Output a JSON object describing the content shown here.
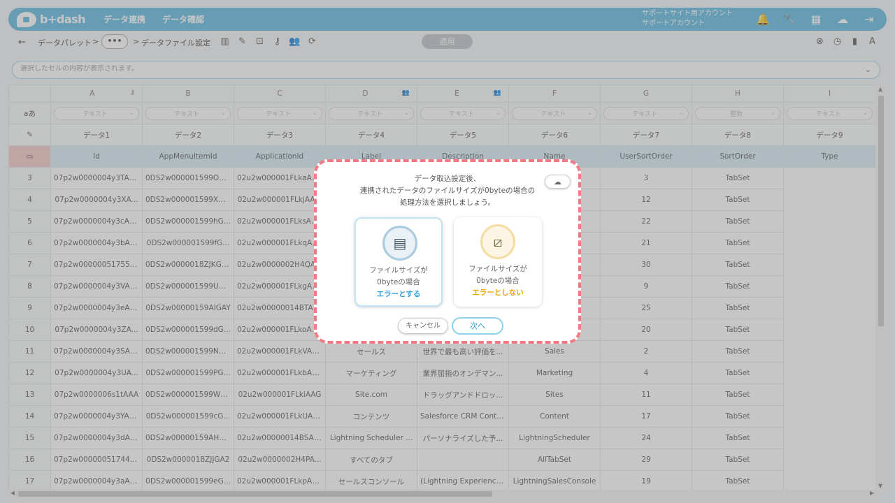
{
  "brand": {
    "logo_text": "b+dash"
  },
  "topnav": {
    "items": [
      "データ連携",
      "データ確認"
    ]
  },
  "account": {
    "line1": "サポートサイト用アカウント",
    "line2": "サポートアカウント"
  },
  "toolbar": {
    "back": "←",
    "crumb1": "データパレット",
    "sep": ">",
    "more": "•••",
    "crumb2": "データファイル設定",
    "apply": "適用"
  },
  "cellbar": {
    "placeholder": "選択したセルの内容が表示されます。"
  },
  "grid": {
    "columns": [
      "A",
      "B",
      "C",
      "D",
      "E",
      "F",
      "G",
      "H",
      "I"
    ],
    "type_label": "aあ",
    "types": [
      "テキスト",
      "テキスト",
      "テキスト",
      "テキスト",
      "テキスト",
      "テキスト",
      "テキスト",
      "整数",
      "テキスト"
    ],
    "labels": [
      "データ1",
      "データ2",
      "データ3",
      "データ4",
      "データ5",
      "データ6",
      "データ7",
      "データ8",
      "データ9"
    ],
    "fields": [
      "Id",
      "AppMenuItemId",
      "ApplicationId",
      "Label",
      "Description",
      "Name",
      "UserSortOrder",
      "SortOrder",
      "Type"
    ],
    "rows": [
      [
        "3",
        "07p2w0000004y3TAAQ",
        "0DS2w000001599OG...",
        "02u2w000001FLkaAA...",
        "",
        "",
        "",
        "3",
        "TabSet"
      ],
      [
        "4",
        "07p2w0000004y3XA...",
        "0DS2w000001599XG...",
        "02u2w000001FLkjAA...",
        "",
        "",
        "",
        "12",
        "TabSet"
      ],
      [
        "5",
        "07p2w0000004y3cAAA",
        "0DS2w000001599hG...",
        "02u2w000001FLksAA...",
        "",
        "",
        "",
        "22",
        "TabSet"
      ],
      [
        "6",
        "07p2w0000004y3bAAA",
        "0DS2w000001599fG...",
        "02u2w000001FLkqAA...",
        "",
        "",
        "",
        "21",
        "TabSet"
      ],
      [
        "7",
        "07p2w00000051755AAA",
        "0DS2w0000018ZJKGA2",
        "02u2w0000002H4QA...",
        "",
        "",
        "",
        "30",
        "TabSet"
      ],
      [
        "8",
        "07p2w0000004y3VAAQ",
        "0DS2w000001599UG...",
        "02u2w000001FLkgAA...",
        "",
        "",
        "",
        "9",
        "TabSet"
      ],
      [
        "9",
        "07p2w0000004y3eAAA",
        "0DS2w00000159AIGAY",
        "02u2w00000014BTAA...",
        "",
        "",
        "",
        "25",
        "TabSet"
      ],
      [
        "10",
        "07p2w0000004y3ZA...",
        "0DS2w000001599dG...",
        "02u2w000001FLkoAA...",
        "",
        "",
        "",
        "20",
        "TabSet"
      ],
      [
        "11",
        "07p2w0000004y3SAAQ",
        "0DS2w000001599NG...",
        "02u2w000001FLkVAAW",
        "セールス",
        "世界で最も高い評価を...",
        "Sales",
        "2",
        "TabSet"
      ],
      [
        "12",
        "07p2w0000004y3UA...",
        "0DS2w000001599PG...",
        "02u2w000001FLkbAAG",
        "マーケティング",
        "業界屈指のオンデマン...",
        "Marketing",
        "4",
        "TabSet"
      ],
      [
        "13",
        "07p2w0000006s1tAAA",
        "0DS2w000001599WG...",
        "02u2w000001FLkiAAG",
        "Site.com",
        "ドラッグアンドドロッ...",
        "Sites",
        "11",
        "TabSet"
      ],
      [
        "14",
        "07p2w0000004y3YAAQ",
        "0DS2w000001599cG...",
        "02u2w000001FLkUAA...",
        "コンテンツ",
        "Salesforce CRM Content",
        "Content",
        "17",
        "TabSet"
      ],
      [
        "15",
        "07p2w0000004y3dAAA",
        "0DS2w00000159AHG...",
        "02u2w00000014BSAAY",
        "Lightning Scheduler ...",
        "パーソナライズした予...",
        "LightningScheduler",
        "24",
        "TabSet"
      ],
      [
        "16",
        "07p2w00000051744AAA",
        "0DS2w0000018ZJJGA2",
        "02u2w0000002H4PA...",
        "すべてのタブ",
        "",
        "AllTabSet",
        "29",
        "TabSet"
      ],
      [
        "17",
        "07p2w0000004y3aAAA",
        "0DS2w000001599eG...",
        "02u2w000001FLkpAAG",
        "セールスコンソール",
        "(Lightning Experience...",
        "LightningSalesConsole",
        "19",
        "TabSet"
      ]
    ]
  },
  "modal": {
    "message_line1": "データ取込設定後、",
    "message_line2": "連携されたデータのファイルサイズが0byteの場合の",
    "message_line3": "処理方法を選択しましょう。",
    "option1": {
      "line1": "ファイルサイズが",
      "line2": "0byteの場合",
      "line3": "エラーとする"
    },
    "option2": {
      "line1": "ファイルサイズが",
      "line2": "0byteの場合",
      "line3": "エラーとしない"
    },
    "cancel": "キャンセル",
    "next": "次へ"
  },
  "colors": {
    "topbar": "#5bb8e0",
    "modal_border": "#f07b85",
    "option1_accent": "#2d9fd8",
    "option2_accent": "#f2a400"
  }
}
